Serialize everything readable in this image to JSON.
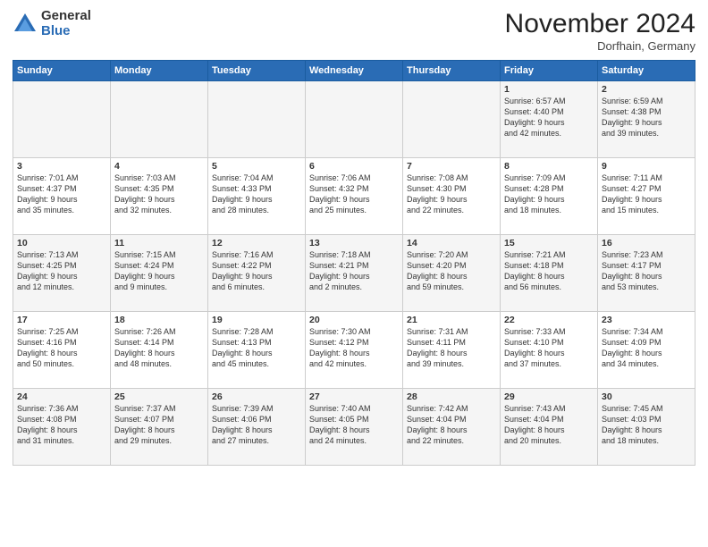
{
  "header": {
    "logo_general": "General",
    "logo_blue": "Blue",
    "month_title": "November 2024",
    "location": "Dorfhain, Germany"
  },
  "days_of_week": [
    "Sunday",
    "Monday",
    "Tuesday",
    "Wednesday",
    "Thursday",
    "Friday",
    "Saturday"
  ],
  "weeks": [
    [
      {
        "day": "",
        "info": ""
      },
      {
        "day": "",
        "info": ""
      },
      {
        "day": "",
        "info": ""
      },
      {
        "day": "",
        "info": ""
      },
      {
        "day": "",
        "info": ""
      },
      {
        "day": "1",
        "info": "Sunrise: 6:57 AM\nSunset: 4:40 PM\nDaylight: 9 hours\nand 42 minutes."
      },
      {
        "day": "2",
        "info": "Sunrise: 6:59 AM\nSunset: 4:38 PM\nDaylight: 9 hours\nand 39 minutes."
      }
    ],
    [
      {
        "day": "3",
        "info": "Sunrise: 7:01 AM\nSunset: 4:37 PM\nDaylight: 9 hours\nand 35 minutes."
      },
      {
        "day": "4",
        "info": "Sunrise: 7:03 AM\nSunset: 4:35 PM\nDaylight: 9 hours\nand 32 minutes."
      },
      {
        "day": "5",
        "info": "Sunrise: 7:04 AM\nSunset: 4:33 PM\nDaylight: 9 hours\nand 28 minutes."
      },
      {
        "day": "6",
        "info": "Sunrise: 7:06 AM\nSunset: 4:32 PM\nDaylight: 9 hours\nand 25 minutes."
      },
      {
        "day": "7",
        "info": "Sunrise: 7:08 AM\nSunset: 4:30 PM\nDaylight: 9 hours\nand 22 minutes."
      },
      {
        "day": "8",
        "info": "Sunrise: 7:09 AM\nSunset: 4:28 PM\nDaylight: 9 hours\nand 18 minutes."
      },
      {
        "day": "9",
        "info": "Sunrise: 7:11 AM\nSunset: 4:27 PM\nDaylight: 9 hours\nand 15 minutes."
      }
    ],
    [
      {
        "day": "10",
        "info": "Sunrise: 7:13 AM\nSunset: 4:25 PM\nDaylight: 9 hours\nand 12 minutes."
      },
      {
        "day": "11",
        "info": "Sunrise: 7:15 AM\nSunset: 4:24 PM\nDaylight: 9 hours\nand 9 minutes."
      },
      {
        "day": "12",
        "info": "Sunrise: 7:16 AM\nSunset: 4:22 PM\nDaylight: 9 hours\nand 6 minutes."
      },
      {
        "day": "13",
        "info": "Sunrise: 7:18 AM\nSunset: 4:21 PM\nDaylight: 9 hours\nand 2 minutes."
      },
      {
        "day": "14",
        "info": "Sunrise: 7:20 AM\nSunset: 4:20 PM\nDaylight: 8 hours\nand 59 minutes."
      },
      {
        "day": "15",
        "info": "Sunrise: 7:21 AM\nSunset: 4:18 PM\nDaylight: 8 hours\nand 56 minutes."
      },
      {
        "day": "16",
        "info": "Sunrise: 7:23 AM\nSunset: 4:17 PM\nDaylight: 8 hours\nand 53 minutes."
      }
    ],
    [
      {
        "day": "17",
        "info": "Sunrise: 7:25 AM\nSunset: 4:16 PM\nDaylight: 8 hours\nand 50 minutes."
      },
      {
        "day": "18",
        "info": "Sunrise: 7:26 AM\nSunset: 4:14 PM\nDaylight: 8 hours\nand 48 minutes."
      },
      {
        "day": "19",
        "info": "Sunrise: 7:28 AM\nSunset: 4:13 PM\nDaylight: 8 hours\nand 45 minutes."
      },
      {
        "day": "20",
        "info": "Sunrise: 7:30 AM\nSunset: 4:12 PM\nDaylight: 8 hours\nand 42 minutes."
      },
      {
        "day": "21",
        "info": "Sunrise: 7:31 AM\nSunset: 4:11 PM\nDaylight: 8 hours\nand 39 minutes."
      },
      {
        "day": "22",
        "info": "Sunrise: 7:33 AM\nSunset: 4:10 PM\nDaylight: 8 hours\nand 37 minutes."
      },
      {
        "day": "23",
        "info": "Sunrise: 7:34 AM\nSunset: 4:09 PM\nDaylight: 8 hours\nand 34 minutes."
      }
    ],
    [
      {
        "day": "24",
        "info": "Sunrise: 7:36 AM\nSunset: 4:08 PM\nDaylight: 8 hours\nand 31 minutes."
      },
      {
        "day": "25",
        "info": "Sunrise: 7:37 AM\nSunset: 4:07 PM\nDaylight: 8 hours\nand 29 minutes."
      },
      {
        "day": "26",
        "info": "Sunrise: 7:39 AM\nSunset: 4:06 PM\nDaylight: 8 hours\nand 27 minutes."
      },
      {
        "day": "27",
        "info": "Sunrise: 7:40 AM\nSunset: 4:05 PM\nDaylight: 8 hours\nand 24 minutes."
      },
      {
        "day": "28",
        "info": "Sunrise: 7:42 AM\nSunset: 4:04 PM\nDaylight: 8 hours\nand 22 minutes."
      },
      {
        "day": "29",
        "info": "Sunrise: 7:43 AM\nSunset: 4:04 PM\nDaylight: 8 hours\nand 20 minutes."
      },
      {
        "day": "30",
        "info": "Sunrise: 7:45 AM\nSunset: 4:03 PM\nDaylight: 8 hours\nand 18 minutes."
      }
    ]
  ]
}
